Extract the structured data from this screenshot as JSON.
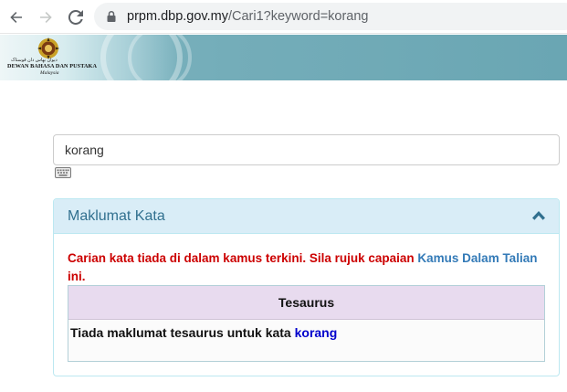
{
  "browser": {
    "url_host": "prpm.dbp.gov.my",
    "url_path": "/Cari1?keyword=korang"
  },
  "header": {
    "jawi_text": "ديوان بهاس دان ڤوستاک",
    "org_name": "DEWAN BAHASA DAN PUSTAKA",
    "country": "Malaysia",
    "colors": {
      "banner": "#74adb9"
    }
  },
  "search": {
    "value": "korang"
  },
  "panel": {
    "title": "Maklumat Kata",
    "notice_text": "Carian kata tiada di dalam kamus terkini. Sila rujuk capaian ",
    "notice_link": "Kamus Dalam Talian",
    "notice_suffix": " ini.",
    "thesaurus_header": "Tesaurus",
    "thesaurus_text": "Tiada maklumat tesaurus untuk kata ",
    "thesaurus_keyword": "korang",
    "colors": {
      "heading_bg": "#d9edf7",
      "title": "#31708f",
      "notice": "#cc0000",
      "link": "#337ab7",
      "table_head_bg": "#e8dbef",
      "keyword": "#0000cc"
    }
  }
}
